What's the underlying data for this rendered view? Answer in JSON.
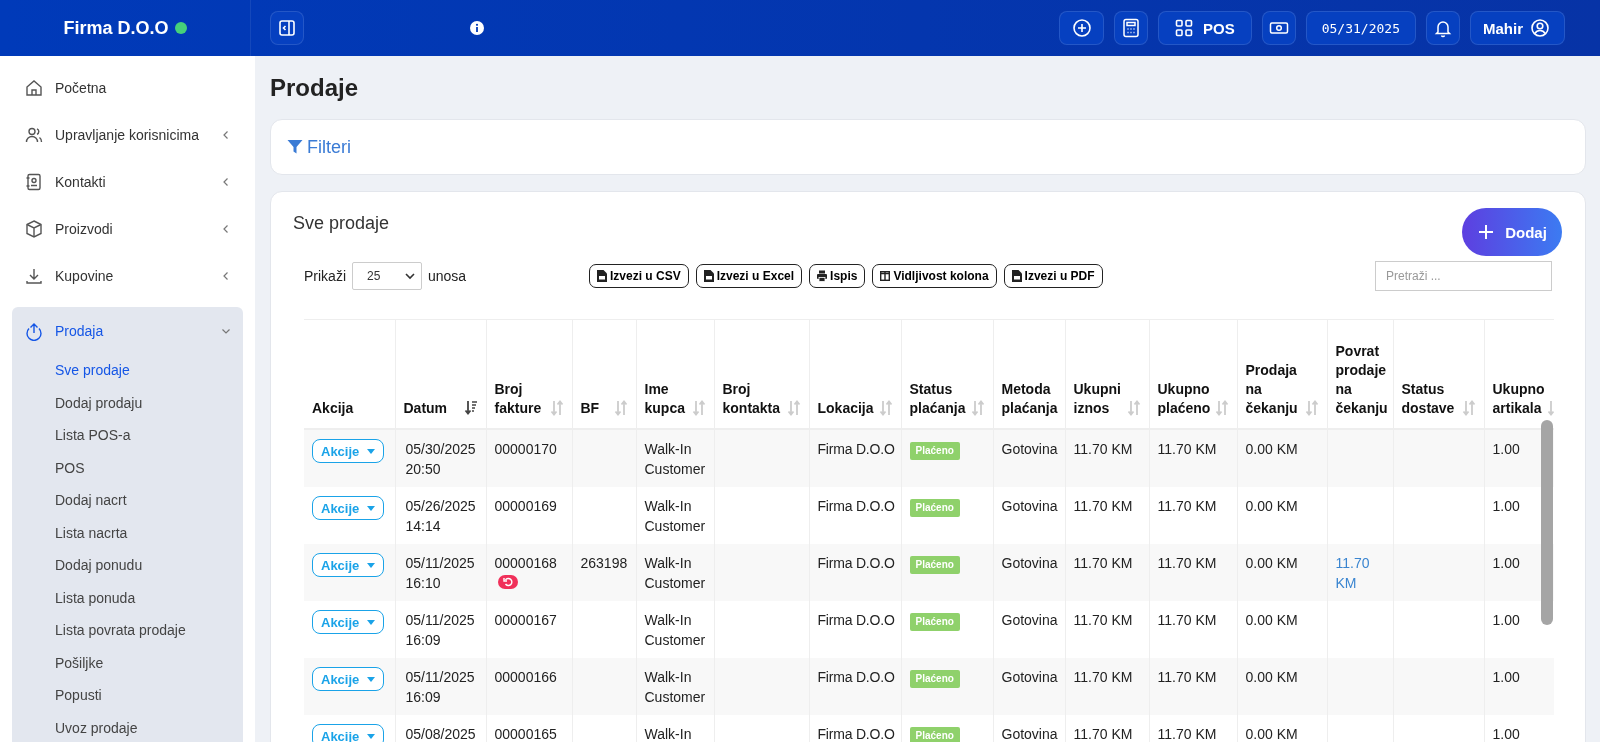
{
  "header": {
    "brand": "Firma D.O.O",
    "online": true,
    "pos_label": "POS",
    "date": "05/31/2025",
    "user": "Mahir"
  },
  "sidebar": {
    "items": [
      {
        "label": "Početna",
        "has_submenu": false,
        "expanded": false,
        "selected": false
      },
      {
        "label": "Upravljanje korisnicima",
        "has_submenu": true,
        "expanded": false,
        "selected": false
      },
      {
        "label": "Kontakti",
        "has_submenu": true,
        "expanded": false,
        "selected": false
      },
      {
        "label": "Proizvodi",
        "has_submenu": true,
        "expanded": false,
        "selected": false
      },
      {
        "label": "Kupovine",
        "has_submenu": true,
        "expanded": false,
        "selected": false
      },
      {
        "label": "Prodaja",
        "has_submenu": true,
        "expanded": true,
        "selected": true,
        "children": [
          {
            "label": "Sve prodaje",
            "selected": true
          },
          {
            "label": "Dodaj prodaju",
            "selected": false
          },
          {
            "label": "Lista POS-a",
            "selected": false
          },
          {
            "label": "POS",
            "selected": false
          },
          {
            "label": "Dodaj nacrt",
            "selected": false
          },
          {
            "label": "Lista nacrta",
            "selected": false
          },
          {
            "label": "Dodaj ponudu",
            "selected": false
          },
          {
            "label": "Lista ponuda",
            "selected": false
          },
          {
            "label": "Lista povrata prodaje",
            "selected": false
          },
          {
            "label": "Pošiljke",
            "selected": false
          },
          {
            "label": "Popusti",
            "selected": false
          },
          {
            "label": "Uvoz prodaje",
            "selected": false
          }
        ]
      }
    ]
  },
  "page_title": "Prodaje",
  "filters": {
    "label": "Filteri"
  },
  "sales": {
    "title": "Sve prodaje",
    "add_button": "Dodaj",
    "show_label": "Prikaži",
    "page_size": "25",
    "entries_label": "unosa",
    "export_buttons": [
      "Izvezi u CSV",
      "Izvezi u Excel",
      "Ispis",
      "Vidljivost kolona",
      "Izvezi u PDF"
    ],
    "search": {
      "placeholder": "Pretraži ..."
    },
    "table": {
      "columns": [
        {
          "label": "Akcija",
          "sortable": false,
          "sorted": false
        },
        {
          "label": "Datum",
          "sortable": true,
          "sorted": true
        },
        {
          "label": "Broj fakture",
          "sortable": true,
          "sorted": false
        },
        {
          "label": "BF",
          "sortable": true,
          "sorted": false
        },
        {
          "label": "Ime kupca",
          "sortable": true,
          "sorted": false
        },
        {
          "label": "Broj kontakta",
          "sortable": true,
          "sorted": false
        },
        {
          "label": "Lokacija",
          "sortable": true,
          "sorted": false
        },
        {
          "label": "Status plaćanja",
          "sortable": true,
          "sorted": false
        },
        {
          "label": "Metoda plaćanja",
          "sortable": false,
          "sorted": false
        },
        {
          "label": "Ukupni iznos",
          "sortable": true,
          "sorted": false
        },
        {
          "label": "Ukupno plaćeno",
          "sortable": true,
          "sorted": false
        },
        {
          "label": "Prodaja na čekanju",
          "sortable": true,
          "sorted": false
        },
        {
          "label": "Povrat prodaje na čekanju",
          "sortable": false,
          "sorted": false
        },
        {
          "label": "Status dostave",
          "sortable": true,
          "sorted": false
        },
        {
          "label": "Ukupno artikala",
          "sortable": true,
          "sorted": false
        }
      ],
      "rows": [
        {
          "action": "Akcije",
          "date": "05/30/2025 20:50",
          "invoice": "00000170",
          "returned": false,
          "customer": "Walk-In Customer",
          "location": "Firma D.O.O",
          "payment_status": "Plaćeno",
          "payment_method": "Gotovina",
          "total": "11.70 KM",
          "paid": "11.70 KM",
          "pending": "0.00 KM",
          "items": "1.00"
        },
        {
          "action": "Akcije",
          "date": "05/26/2025 14:14",
          "invoice": "00000169",
          "returned": false,
          "customer": "Walk-In Customer",
          "location": "Firma D.O.O",
          "payment_status": "Plaćeno",
          "payment_method": "Gotovina",
          "total": "11.70 KM",
          "paid": "11.70 KM",
          "pending": "0.00 KM",
          "items": "1.00"
        },
        {
          "action": "Akcije",
          "date": "05/11/2025 16:10",
          "invoice": "00000168",
          "returned": true,
          "bf": "263198",
          "customer": "Walk-In Customer",
          "location": "Firma D.O.O",
          "payment_status": "Plaćeno",
          "payment_method": "Gotovina",
          "total": "11.70 KM",
          "paid": "11.70 KM",
          "pending": "0.00 KM",
          "return_pending": "11.70 KM",
          "items": "1.00"
        },
        {
          "action": "Akcije",
          "date": "05/11/2025 16:09",
          "invoice": "00000167",
          "returned": false,
          "customer": "Walk-In Customer",
          "location": "Firma D.O.O",
          "payment_status": "Plaćeno",
          "payment_method": "Gotovina",
          "total": "11.70 KM",
          "paid": "11.70 KM",
          "pending": "0.00 KM",
          "items": "1.00"
        },
        {
          "action": "Akcije",
          "date": "05/11/2025 16:09",
          "invoice": "00000166",
          "returned": false,
          "customer": "Walk-In Customer",
          "location": "Firma D.O.O",
          "payment_status": "Plaćeno",
          "payment_method": "Gotovina",
          "total": "11.70 KM",
          "paid": "11.70 KM",
          "pending": "0.00 KM",
          "items": "1.00"
        },
        {
          "action": "Akcije",
          "date": "05/08/2025",
          "invoice": "00000165",
          "customer": "Walk-In",
          "location": "Firma D.O.O",
          "payment_status": "Plaćeno",
          "payment_method": "Gotovina",
          "total": "11.70 KM",
          "paid": "11.70 KM",
          "pending": "0.00 KM",
          "items": "1.00"
        }
      ]
    }
  }
}
